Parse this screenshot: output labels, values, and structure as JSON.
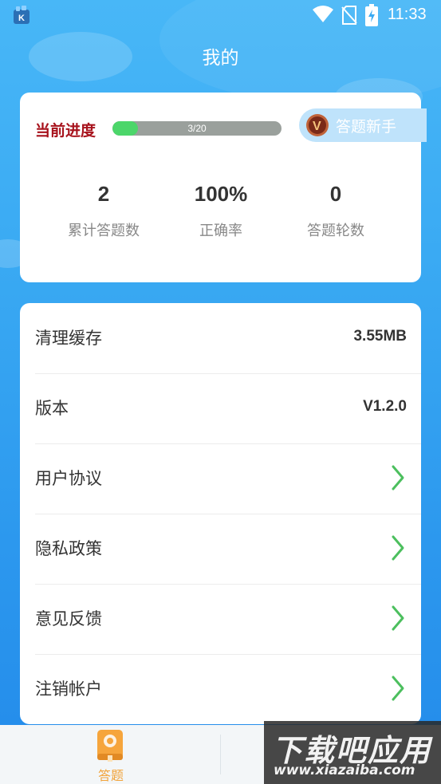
{
  "status_bar": {
    "time": "11:33",
    "icons": [
      "app-notification-icon",
      "wifi-icon",
      "no-sim-icon",
      "battery-charging-icon"
    ]
  },
  "page_title": "我的",
  "progress": {
    "label": "当前进度",
    "current": 3,
    "total": 20,
    "text": "3/20",
    "fill_fraction": 0.15,
    "level_badge": "答题新手",
    "colors": {
      "label": "#a7121c",
      "fill": "#4cd66a",
      "track": "#9aa09c"
    }
  },
  "stats": [
    {
      "value": "2",
      "label": "累计答题数"
    },
    {
      "value": "100%",
      "label": "正确率"
    },
    {
      "value": "0",
      "label": "答题轮数"
    }
  ],
  "settings": [
    {
      "label": "清理缓存",
      "value": "3.55MB"
    },
    {
      "label": "版本",
      "value": "V1.2.0"
    },
    {
      "label": "用户协议",
      "icon": "chevron-right-icon"
    },
    {
      "label": "隐私政策",
      "icon": "chevron-right-icon"
    },
    {
      "label": "意见反馈",
      "icon": "chevron-right-icon"
    },
    {
      "label": "注销帐户",
      "icon": "chevron-right-icon"
    }
  ],
  "bottom_nav": {
    "tabs": [
      {
        "label": "答题",
        "icon": "quiz-book-icon",
        "active": true
      }
    ]
  },
  "watermark": {
    "main": "下载吧应用",
    "sub": "www.xiazaiba.com"
  },
  "theme": {
    "accent": "#3aaaf3",
    "chevron": "#4cbf5e",
    "tab_active": "#f2a33a"
  }
}
